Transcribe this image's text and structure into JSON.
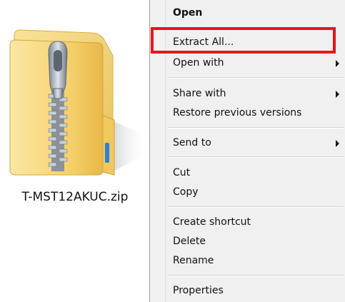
{
  "file": {
    "name": "T-MST12AKUC.zip",
    "icon": "zip-folder-icon"
  },
  "menu": {
    "items": [
      {
        "label": "Open",
        "bold": true,
        "submenu": false
      },
      {
        "label": "Extract All...",
        "bold": false,
        "submenu": false
      },
      {
        "label": "Open with",
        "bold": false,
        "submenu": true
      },
      {
        "label": "Share with",
        "bold": false,
        "submenu": true
      },
      {
        "label": "Restore previous versions",
        "bold": false,
        "submenu": false
      },
      {
        "label": "Send to",
        "bold": false,
        "submenu": true
      },
      {
        "label": "Cut",
        "bold": false,
        "submenu": false
      },
      {
        "label": "Copy",
        "bold": false,
        "submenu": false
      },
      {
        "label": "Create shortcut",
        "bold": false,
        "submenu": false
      },
      {
        "label": "Delete",
        "bold": false,
        "submenu": false
      },
      {
        "label": "Rename",
        "bold": false,
        "submenu": false
      },
      {
        "label": "Properties",
        "bold": false,
        "submenu": false
      }
    ],
    "highlighted": "Extract All..."
  },
  "colors": {
    "highlight": "#e8141c",
    "menu_background": "#f0f0f0",
    "folder": "#f6d46e"
  }
}
